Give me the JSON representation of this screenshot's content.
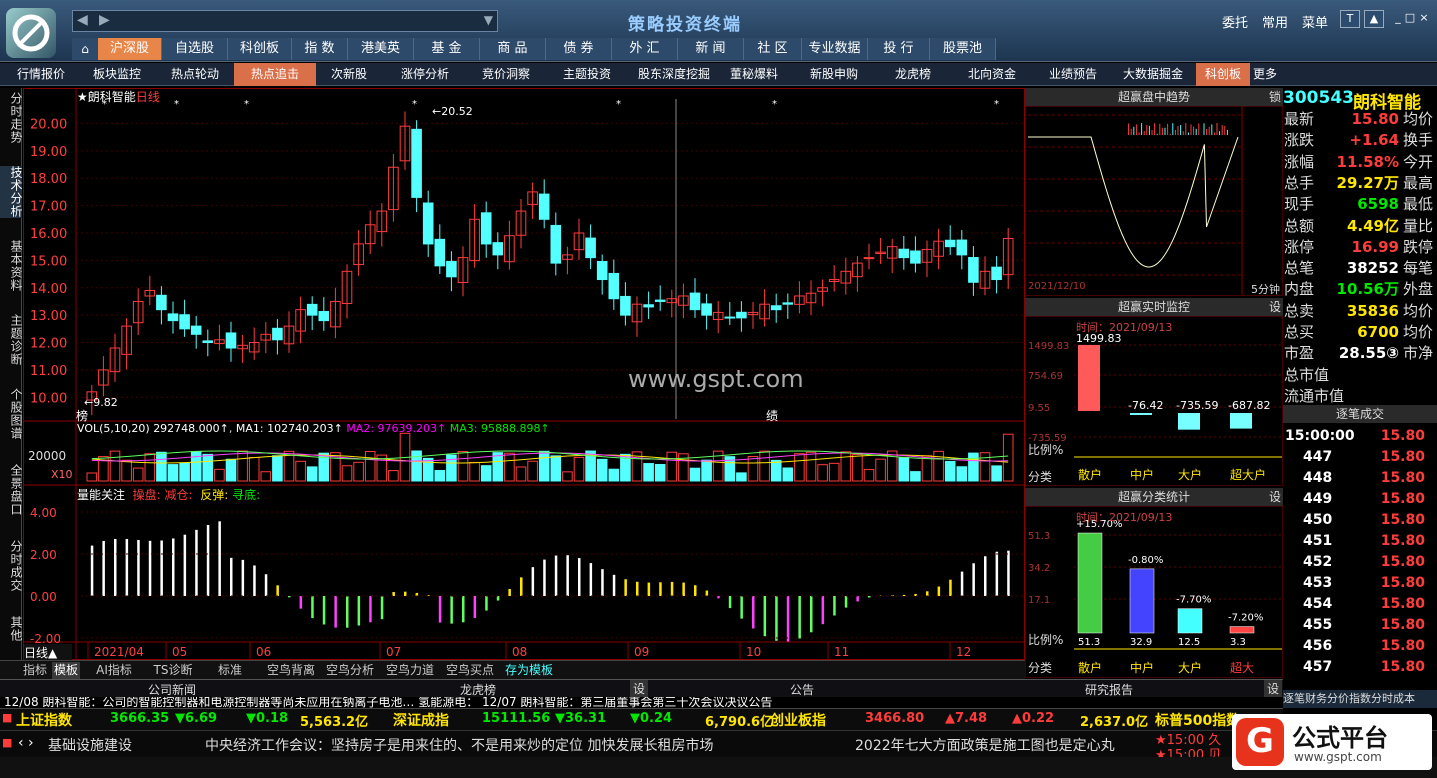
{
  "titlebar": {
    "app_title": "策略投资终端",
    "links": [
      "委托",
      "常用",
      "菜单"
    ],
    "window_buttons": [
      "T",
      "▲",
      "_",
      "□",
      "×"
    ]
  },
  "nav": {
    "items": [
      "沪深股",
      "自选股",
      "科创板",
      "指 数",
      "港美英",
      "基 金",
      "商 品",
      "债 券",
      "外 汇",
      "新 闻",
      "社 区",
      "专业数据",
      "投 行",
      "股票池"
    ],
    "active": 0
  },
  "subnav": {
    "items": [
      "行情报价",
      "板块监控",
      "热点轮动",
      "热点追击",
      "次新股",
      "涨停分析",
      "竞价洞察",
      "主题投资",
      "股东深度挖掘",
      "董秘爆料",
      "新股申购",
      "龙虎榜",
      "北向资金",
      "业绩预告",
      "大数据掘金",
      "科创板",
      "更多"
    ],
    "active": [
      3,
      15
    ]
  },
  "leftbar": {
    "tabs": [
      "分时走势",
      "技术分析",
      "基本资料",
      "主题诊断",
      "个股图谱",
      "全景盘口",
      "分时成交",
      "其他"
    ],
    "selected": 1
  },
  "chart": {
    "header_star": "★",
    "stock_name": "朗科智能",
    "period": "日线",
    "high_label": "20.52",
    "low_label": "9.82",
    "marker_bang": "榜",
    "marker_ji": "绩",
    "watermark": "www.gspt.com",
    "price_ticks": [
      "20.00",
      "19.00",
      "18.00",
      "17.00",
      "16.00",
      "15.00",
      "14.00",
      "13.00",
      "12.00",
      "11.00",
      "10.00"
    ],
    "vol_header": {
      "name": "VOL(5,10,20)",
      "v": "292748.000↑",
      "ma1": "MA1: 102740.203↑",
      "ma2": "MA2: 97639.203↑",
      "ma3": "MA3: 95888.898↑"
    },
    "vol_tick": "20000",
    "vol_mult": "X10",
    "ind_header": {
      "name": "量能关注",
      "a": "操盘:",
      "b": "减仓:",
      "c": "反弹:",
      "d": "寻底:"
    },
    "ind_ticks": [
      "4.00",
      "2.00",
      "0.00",
      "-2.00"
    ],
    "months": [
      "2021/04",
      "05",
      "06",
      "07",
      "08",
      "09",
      "10",
      "11",
      "12"
    ],
    "period_btn": "日线▲"
  },
  "chart_data": {
    "type": "candlestick",
    "x_first": "2021/04",
    "x_last": "2021/12",
    "price_range": [
      9.82,
      20.52
    ],
    "last_close": 15.8,
    "closes": [
      10.2,
      11.0,
      11.8,
      12.6,
      13.5,
      13.9,
      13.2,
      12.8,
      12.5,
      12.3,
      12.0,
      12.1,
      11.8,
      11.9,
      12.0,
      12.3,
      12.1,
      12.6,
      13.2,
      13.0,
      12.8,
      13.5,
      14.6,
      15.6,
      16.3,
      16.8,
      18.4,
      19.9,
      17.3,
      15.6,
      14.8,
      14.4,
      15.1,
      16.5,
      15.6,
      15.2,
      15.9,
      16.8,
      17.5,
      16.5,
      14.9,
      15.2,
      16.0,
      15.1,
      14.3,
      13.6,
      13.0,
      13.4,
      13.3,
      13.5,
      13.6,
      13.7,
      13.2,
      13.0,
      13.1,
      12.9,
      12.9,
      13.1,
      13.4,
      13.2,
      13.4,
      13.7,
      13.8,
      14.0,
      14.3,
      14.6,
      14.9,
      15.1,
      15.3,
      15.5,
      15.1,
      14.9,
      15.4,
      15.7,
      15.5,
      15.2,
      14.2,
      14.6,
      14.3,
      15.8
    ]
  },
  "tabs_bottom": [
    "指标",
    "模板",
    "AI指标",
    "TS诊断",
    "标准",
    "空鸟背离",
    "空鸟分析",
    "空鸟力道",
    "空鸟买点",
    "存为模板"
  ],
  "news": {
    "headers": [
      "公司新闻",
      "龙虎榜",
      "公告",
      "研究报告"
    ],
    "settings": "设",
    "row": "12/08 朗科智能：公司的智能控制器和电源控制器等尚未应用在钠离子电池…  氢能源电：  12/07 朗科智能：第三届董事会第三十次会议决议公告"
  },
  "ticker1": [
    {
      "name": "上证指数",
      "price": "3666.35",
      "chg": "▼6.69",
      "pct": "▼0.18",
      "amt": "5,563.2亿"
    },
    {
      "name": "深证成指",
      "price": "15111.56",
      "chg": "▼36.31",
      "pct": "▼0.24",
      "amt": "6,790.6亿"
    },
    {
      "name": "创业板指",
      "price": "3466.80",
      "chg": "▲7.48",
      "pct": "▲0.22",
      "amt": "2,637.0亿"
    },
    {
      "name": "标普500指数"
    }
  ],
  "ticker2": {
    "arrows": "‹ ›",
    "items": [
      "基础设施建设",
      "中央经济工作会议：坚持房子是用来住的、不是用来炒的定位 加快发展长租房市场",
      "2022年七大方面政策是施工图也是定心丸"
    ],
    "time1": "★15:00 久",
    "time2": "★15:00 贝"
  },
  "brand": {
    "name": "公式平台",
    "url": "www.gspt.com"
  },
  "right": {
    "intraday_title": "超赢盘中趋势",
    "intraday_btn": "锁",
    "intraday_date": "2021/12/10",
    "intraday_period": "5分钟",
    "monitor_title": "超赢实时监控",
    "monitor_btn": "设",
    "monitor_time": "时间：2021/09/13",
    "monitor_ticks": [
      "1499.83",
      "754.69",
      "9.55",
      "-735.59"
    ],
    "monitor_values": [
      "1499.83",
      "-76.42",
      "-735.59",
      "-687.82"
    ],
    "monitor_cats": [
      "散户",
      "中户",
      "大户",
      "超大户"
    ],
    "monitor_side": [
      "比例%",
      "分类"
    ],
    "class_title": "超赢分类统计",
    "class_btn": "设",
    "class_time": "时间：2021/09/13",
    "class_ticks": [
      "51.3",
      "34.2",
      "17.1"
    ],
    "class_pcts": [
      "+15.70%",
      "-0.80%",
      "-7.70%",
      "-7.20%"
    ],
    "class_vals": [
      "51.3",
      "32.9",
      "12.5",
      "3.3"
    ],
    "class_cats": [
      "散户",
      "中户",
      "大户",
      "超大"
    ],
    "class_side": [
      "比例%",
      "分类"
    ]
  },
  "quote": {
    "code": "300543",
    "name": "朗科智能",
    "rows": [
      [
        "最新",
        "15.80",
        "均价"
      ],
      [
        "涨跌",
        "+1.64",
        "换手"
      ],
      [
        "涨幅",
        "11.58%",
        "今开"
      ],
      [
        "总手",
        "29.27万",
        "最高"
      ],
      [
        "现手",
        "6598",
        "最低"
      ],
      [
        "总额",
        "4.49亿",
        "量比"
      ],
      [
        "涨停",
        "16.99",
        "跌停"
      ],
      [
        "总笔",
        "38252",
        "每笔"
      ],
      [
        "内盘",
        "10.56万",
        "外盘"
      ],
      [
        "总卖",
        "35836",
        "均价"
      ],
      [
        "总买",
        "6700",
        "均价"
      ],
      [
        "市盈",
        "28.55③",
        "市净"
      ],
      [
        "总市值",
        "",
        ""
      ],
      [
        "流通市值",
        "",
        ""
      ]
    ],
    "trades_title": "逐笔成交",
    "trades": [
      [
        "15:00:00",
        "15.80"
      ],
      [
        "447",
        "15.80"
      ],
      [
        "448",
        "15.80"
      ],
      [
        "449",
        "15.80"
      ],
      [
        "450",
        "15.80"
      ],
      [
        "451",
        "15.80"
      ],
      [
        "452",
        "15.80"
      ],
      [
        "453",
        "15.80"
      ],
      [
        "454",
        "15.80"
      ],
      [
        "455",
        "15.80"
      ],
      [
        "456",
        "15.80"
      ],
      [
        "457",
        "15.80"
      ]
    ],
    "bottom_tabs": "逐笔财务分价指数分时成本"
  },
  "colors": {
    "up": "#ff3c3c",
    "down": "#54ffff",
    "ma_yellow": "#ffe600",
    "ma_purple": "#ff40ff",
    "ma_green": "#60ff60"
  }
}
